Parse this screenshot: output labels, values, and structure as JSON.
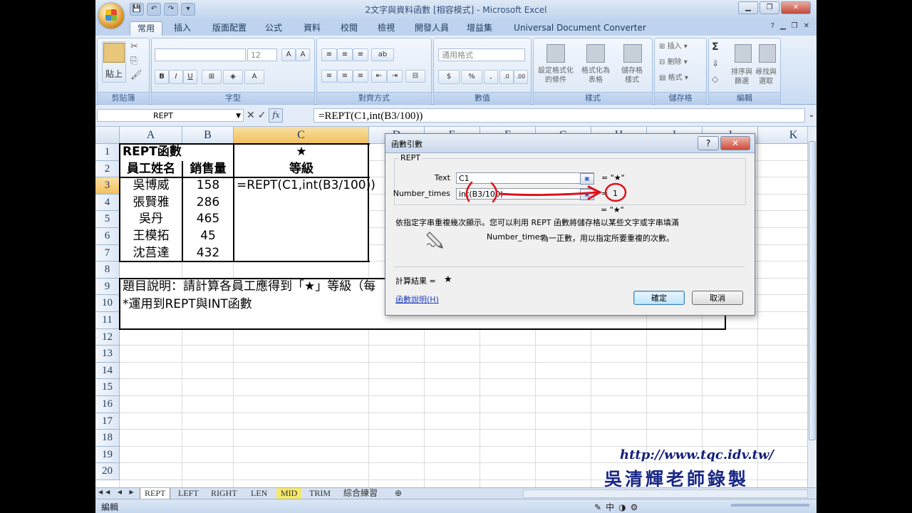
{
  "window": {
    "title": "2文字與資料函數 [相容模式] - Microsoft Excel",
    "controls": {
      "minimize": "▁",
      "restore": "❐",
      "close": "✕"
    }
  },
  "quick_access": [
    "save-icon",
    "undo-icon",
    "redo-icon",
    "dropdown-icon"
  ],
  "tabs": [
    "常用",
    "插入",
    "版面配置",
    "公式",
    "資料",
    "校閱",
    "檢視",
    "開發人員",
    "增益集",
    "Universal Document Converter"
  ],
  "active_tab": "常用",
  "ribbon": {
    "clipboard": {
      "paste": "貼上",
      "label": "剪貼簿"
    },
    "font": {
      "size": "12",
      "label": "字型",
      "bold": "B",
      "italic": "I",
      "underline": "U"
    },
    "alignment": {
      "label": "對齊方式"
    },
    "number": {
      "format": "通用格式",
      "label": "數值",
      "percent": "%"
    },
    "styles": {
      "cond": "設定格式化\n的條件",
      "table": "格式化為\n表格",
      "cell": "儲存格\n樣式",
      "label": "樣式"
    },
    "cells": {
      "insert": "插入",
      "delete": "刪除",
      "format": "格式",
      "label": "儲存格"
    },
    "editing": {
      "sort": "排序與\n篩選",
      "find": "尋找與\n選取",
      "label": "編輯",
      "sum": "Σ"
    }
  },
  "formula_bar": {
    "name_box": "REPT",
    "formula": "=REPT(C1,int(B3/100))"
  },
  "columns": [
    "A",
    "B",
    "C",
    "D",
    "E",
    "F",
    "G",
    "H",
    "I",
    "J",
    "K"
  ],
  "rows": [
    "1",
    "2",
    "3",
    "4",
    "5",
    "6",
    "7",
    "8",
    "9",
    "10",
    "11",
    "12",
    "13",
    "14",
    "15",
    "16",
    "17",
    "18",
    "19",
    "20"
  ],
  "sheet": {
    "title": "REPT函數",
    "star_header": "★",
    "hdr_name": "員工姓名",
    "hdr_sales": "銷售量",
    "hdr_grade": "等級",
    "employees": [
      {
        "name": "吳博威",
        "sales": "158"
      },
      {
        "name": "張賢雅",
        "sales": "286"
      },
      {
        "name": "吳丹",
        "sales": "465"
      },
      {
        "name": "王模拓",
        "sales": "45"
      },
      {
        "name": "沈莒達",
        "sales": "432"
      }
    ],
    "editing_cell": "=REPT(C1,int(B3/100))",
    "note_line1": "題目說明：請計算各員工應得到「★」等級（每",
    "note_line2": "*運用到REPT與INT函數"
  },
  "dialog": {
    "title": "函數引數",
    "function": "REPT",
    "arg1_label": "Text",
    "arg1_value": "C1",
    "arg1_result": "= \"★\"",
    "arg2_label": "Number_times",
    "arg2_value": "int(B3/100)",
    "arg2_result_eq": "=",
    "arg2_result": "1",
    "total_result": "= \"★\"",
    "description": "依指定字串重複幾次顯示。您可以利用 REPT 函數將儲存格以某些文字或字串填滿",
    "arg_help_name": "Number_times",
    "arg_help": "為一正數，用以指定所要重複的次數。",
    "calc_label": "計算結果 =",
    "calc_value": "★",
    "help_link": "函數說明(H)",
    "ok": "確定",
    "cancel": "取消",
    "help_btn": "?",
    "close_btn": "✕",
    "annotation_color": "#e0101a"
  },
  "sheet_tabs": [
    "REPT",
    "LEFT",
    "RIGHT",
    "LEN",
    "MID",
    "TRIM",
    "綜合練習"
  ],
  "active_sheet": "REPT",
  "status": {
    "mode": "編輯",
    "ime": "中"
  },
  "watermark": {
    "url": "http://www.tqc.idv.tw/",
    "author": "吳清輝老師錄製"
  }
}
